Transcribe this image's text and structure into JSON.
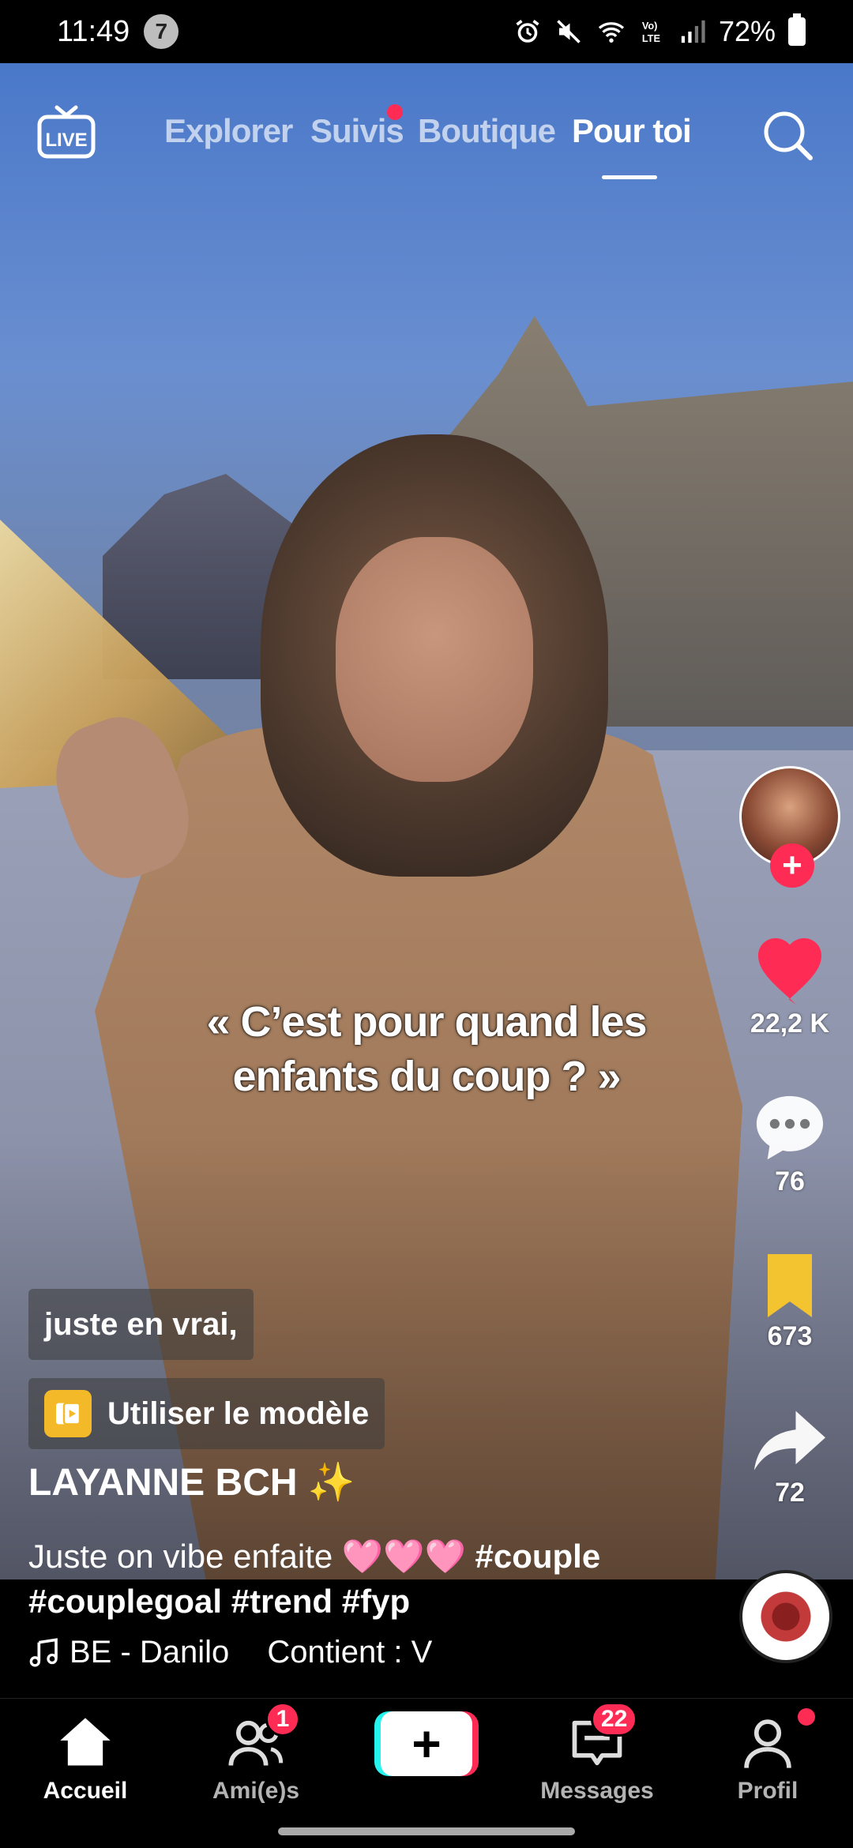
{
  "status_bar": {
    "time": "11:49",
    "notification_count": "7",
    "battery": "72%"
  },
  "top_nav": {
    "live_label": "LIVE",
    "tabs": [
      {
        "label": "Explorer"
      },
      {
        "label": "Suivis"
      },
      {
        "label": "Boutique"
      },
      {
        "label": "Pour toi"
      }
    ],
    "active_tab": "Pour toi"
  },
  "video": {
    "caption_line1": "« C’est pour quand les",
    "caption_line2": "enfants du coup ? »"
  },
  "actions": {
    "likes": "22,2 K",
    "comments": "76",
    "saves": "673",
    "shares": "72"
  },
  "info": {
    "text_chip": "juste en vrai,",
    "template_label": "Utiliser le modèle",
    "username": "LAYANNE BCH ✨",
    "description_text": "Juste on vibe enfaite 🩷🩷🩷",
    "hashtag_couple": "#couple",
    "hashtags_line2": "#couplegoal #trend #fyp",
    "music": "BE - Danilo",
    "contains": "Contient : V"
  },
  "bottom_nav": {
    "items": [
      {
        "label": "Accueil"
      },
      {
        "label": "Ami(e)s",
        "badge": "1"
      },
      {
        "label": "Messages",
        "badge": "22"
      },
      {
        "label": "Profil"
      }
    ]
  },
  "colors": {
    "accent": "#fe2c55",
    "cyan": "#25f4ee",
    "bookmark": "#f4c430",
    "template_icon": "#f4b928"
  }
}
